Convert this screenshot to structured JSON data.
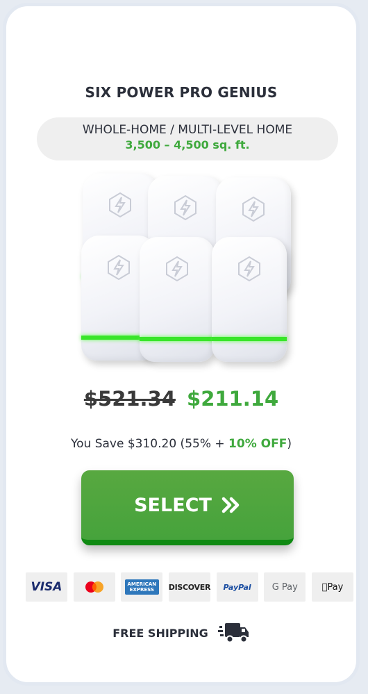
{
  "product": {
    "title": "SIX POWER PRO GENIUS",
    "coverage_label": "WHOLE-HOME / MULTI-LEVEL HOME",
    "coverage_area": "3,500 – 4,500 sq. ft."
  },
  "pricing": {
    "original_price": "$521.34",
    "sale_price": "$211.14",
    "savings_prefix": "You Save $310.20 (55% + ",
    "savings_off": "10% OFF",
    "savings_suffix": ")"
  },
  "cta": {
    "select_label": "SELECT"
  },
  "payments": {
    "visa": "VISA",
    "amex_line1": "AMERICAN",
    "amex_line2": "EXPRESS",
    "discover": "DISCOVER",
    "paypal": "PayPal",
    "gpay": "G Pay",
    "applepay": "Pay"
  },
  "shipping": {
    "label": "FREE SHIPPING"
  },
  "colors": {
    "accent_green": "#3fa93d",
    "button_green": "#4ea63f",
    "led_green": "#39e52a"
  },
  "icons": [
    "device-logo-icon",
    "double-chevron-right-icon",
    "mastercard-icon",
    "truck-icon"
  ]
}
